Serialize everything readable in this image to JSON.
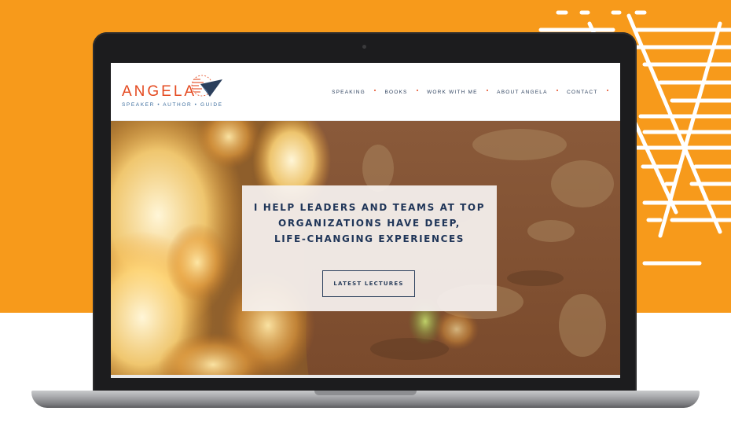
{
  "colors": {
    "background_orange": "#f79a1b",
    "accent": "#e4491f",
    "navy": "#1f3558",
    "tagline_blue": "#3e6e9e"
  },
  "site": {
    "logo": {
      "name": "ANGELA",
      "tagline": "SPEAKER • AUTHOR • GUIDE",
      "mark_icon": "paper-plane-icon"
    },
    "nav": {
      "items": [
        {
          "label": "SPEAKING"
        },
        {
          "label": "BOOKS"
        },
        {
          "label": "WORK WITH ME"
        },
        {
          "label": "ABOUT ANGELA"
        },
        {
          "label": "CONTACT"
        }
      ]
    },
    "hero": {
      "headline_line1": "I HELP LEADERS AND TEAMS AT TOP",
      "headline_line2": "ORGANIZATIONS HAVE DEEP,",
      "headline_line3": "LIFE-CHANGING EXPERIENCES",
      "button_label": "LATEST LECTURES"
    }
  }
}
